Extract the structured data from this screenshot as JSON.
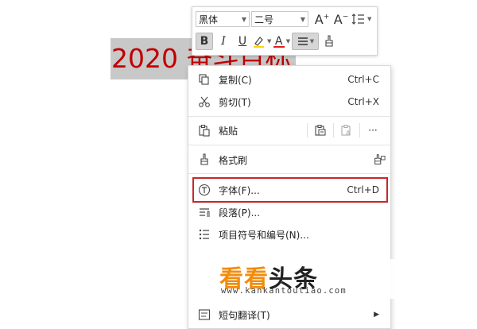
{
  "document": {
    "headline": "2020 奋斗目标"
  },
  "mini_toolbar": {
    "font_family": "黑体",
    "font_size": "二号",
    "grow_font": "A",
    "shrink_font": "A",
    "bold": "B",
    "italic": "I",
    "underline": "U",
    "font_color_letter": "A",
    "font_color": "#e02020",
    "highlight_color": "#ffd400"
  },
  "context_menu": {
    "items": [
      {
        "label": "复制(C)",
        "shortcut": "Ctrl+C"
      },
      {
        "label": "剪切(T)",
        "shortcut": "Ctrl+X"
      },
      {
        "label": "粘贴",
        "shortcut": ""
      },
      {
        "label": "格式刷",
        "shortcut": ""
      },
      {
        "label": "字体(F)...",
        "shortcut": "Ctrl+D"
      },
      {
        "label": "段落(P)...",
        "shortcut": ""
      },
      {
        "label": "项目符号和编号(N)...",
        "shortcut": ""
      },
      {
        "label": "短句翻译(T)",
        "shortcut": ""
      }
    ],
    "more": "···"
  },
  "watermark": {
    "logo_part1": "看看",
    "logo_part2": "头条",
    "url": "www.kankantoutiao.com"
  },
  "colors": {
    "headline_text": "#c00000",
    "selection_bg": "#c8c8c8",
    "highlight_border": "#c62828",
    "logo_orange": "#f28c0c"
  }
}
